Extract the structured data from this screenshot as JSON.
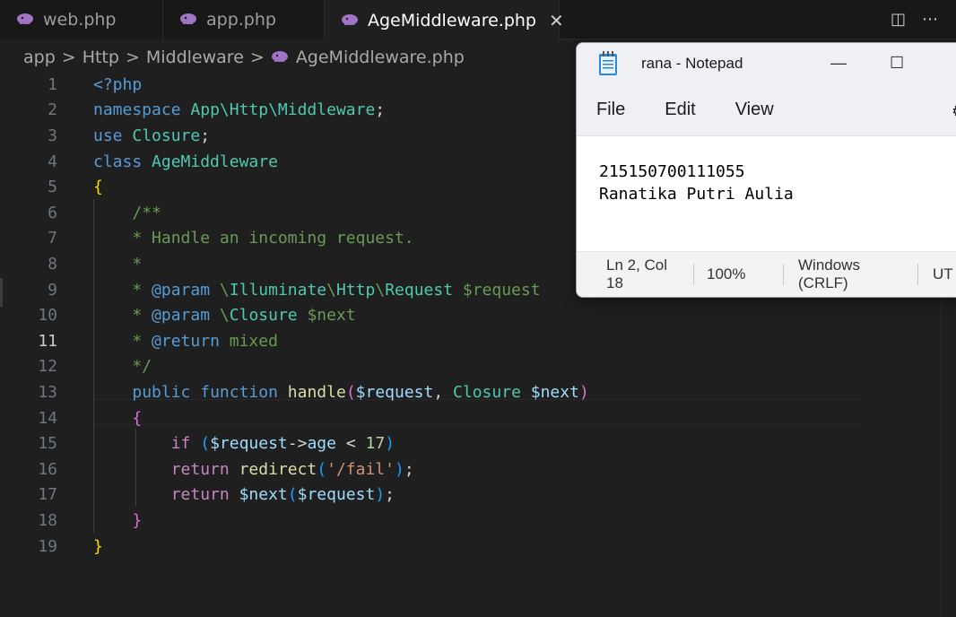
{
  "tabs": [
    {
      "label": "web.php",
      "icon": "php-elephant-icon",
      "active": false
    },
    {
      "label": "app.php",
      "icon": "php-elephant-icon",
      "active": false
    },
    {
      "label": "AgeMiddleware.php",
      "icon": "php-elephant-icon",
      "active": true,
      "close": "✕"
    }
  ],
  "tab_actions": {
    "split": "◫",
    "more": "⋯"
  },
  "breadcrumb": [
    "app",
    "Http",
    "Middleware",
    "AgeMiddleware.php"
  ],
  "breadcrumb_sep": ">",
  "editor": {
    "current_line": 11,
    "line_numbers": [
      "1",
      "2",
      "3",
      "4",
      "5",
      "6",
      "7",
      "8",
      "9",
      "10",
      "11",
      "12",
      "13",
      "14",
      "15",
      "16",
      "17",
      "18",
      "19"
    ]
  },
  "notepad": {
    "title": "rana - Notepad",
    "minimize": "—",
    "maximize": "☐",
    "menu": [
      "File",
      "Edit",
      "View"
    ],
    "settings_icon": "⚙",
    "content_line1": "215150700111055",
    "content_line2": "Ranatika Putri Aulia",
    "status": {
      "position": "Ln 2, Col 18",
      "zoom": "100%",
      "line_ending": "Windows (CRLF)",
      "encoding": "UT"
    }
  },
  "colors": {
    "php_icon": "#a074c4",
    "editor_bg": "#1f1f1f"
  }
}
